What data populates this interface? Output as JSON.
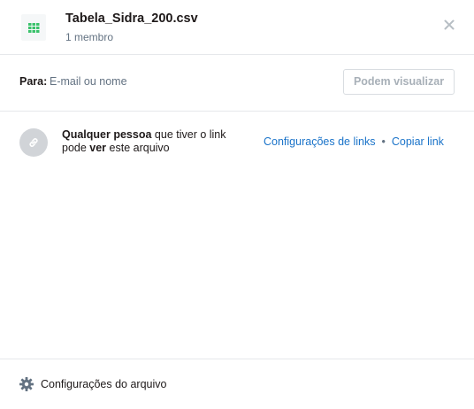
{
  "header": {
    "file_name": "Tabela_Sidra_200.csv",
    "members": "1 membro"
  },
  "share": {
    "to_label": "Para:",
    "input_placeholder": "E-mail ou nome",
    "permission_label": "Podem visualizar"
  },
  "link": {
    "text_part1_bold": "Qualquer pessoa",
    "text_part2": " que tiver o link pode ",
    "text_part3_bold": "ver",
    "text_part4": " este arquivo",
    "settings_label": "Configurações de links",
    "separator": "•",
    "copy_label": "Copiar link"
  },
  "footer": {
    "settings_label": "Configurações do arquivo"
  },
  "icons": {
    "file": "csv-spreadsheet-icon",
    "close": "close-icon",
    "link": "link-icon",
    "gear": "gear-icon"
  },
  "colors": {
    "accent": "#1a73c9",
    "file_icon_green": "#3ac26b",
    "muted": "#637282"
  }
}
